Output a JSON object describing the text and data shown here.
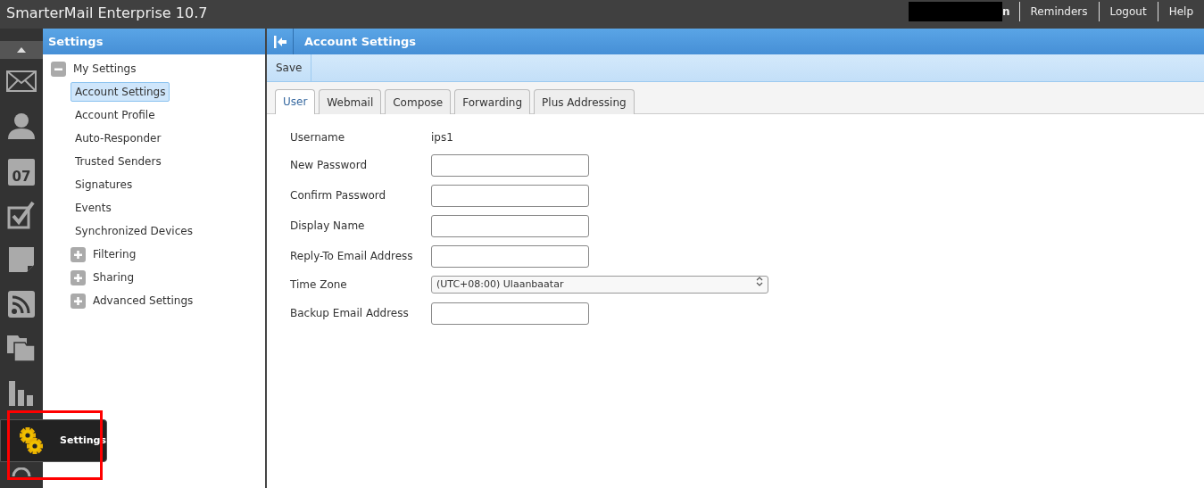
{
  "app_title": "SmarterMail Enterprise 10.7",
  "user_name_fragment": "n",
  "top_links": [
    "Reminders",
    "Logout",
    "Help"
  ],
  "nav": {
    "calendar_day": "07",
    "tooltip": "Settings"
  },
  "sidebar": {
    "title": "Settings",
    "tree": [
      {
        "label": "My Settings",
        "expanded": true,
        "children": [
          {
            "label": "Account Settings",
            "selected": true
          },
          {
            "label": "Account Profile",
            "selected": false
          },
          {
            "label": "Auto-Responder",
            "selected": false
          },
          {
            "label": "Trusted Senders",
            "selected": false
          },
          {
            "label": "Signatures",
            "selected": false
          },
          {
            "label": "Events",
            "selected": false
          },
          {
            "label": "Synchronized Devices",
            "selected": false
          }
        ]
      },
      {
        "label": "Filtering",
        "expanded": false
      },
      {
        "label": "Sharing",
        "expanded": false
      },
      {
        "label": "Advanced Settings",
        "expanded": false
      }
    ]
  },
  "main": {
    "title": "Account Settings",
    "toolbar": [
      "Save"
    ],
    "tabs": [
      {
        "label": "User",
        "selected": true
      },
      {
        "label": "Webmail",
        "selected": false
      },
      {
        "label": "Compose",
        "selected": false
      },
      {
        "label": "Forwarding",
        "selected": false
      },
      {
        "label": "Plus Addressing",
        "selected": false
      }
    ],
    "form": [
      {
        "label": "Username",
        "kind": "text",
        "value": "ips1"
      },
      {
        "label": "New Password",
        "kind": "input"
      },
      {
        "label": "Confirm Password",
        "kind": "input"
      },
      {
        "label": "Display Name",
        "kind": "input"
      },
      {
        "label": "Reply-To Email Address",
        "kind": "input"
      },
      {
        "label": "Time Zone",
        "kind": "select",
        "value": "(UTC+08:00) Ulaanbaatar"
      },
      {
        "label": "Backup Email Address",
        "kind": "input"
      }
    ]
  }
}
